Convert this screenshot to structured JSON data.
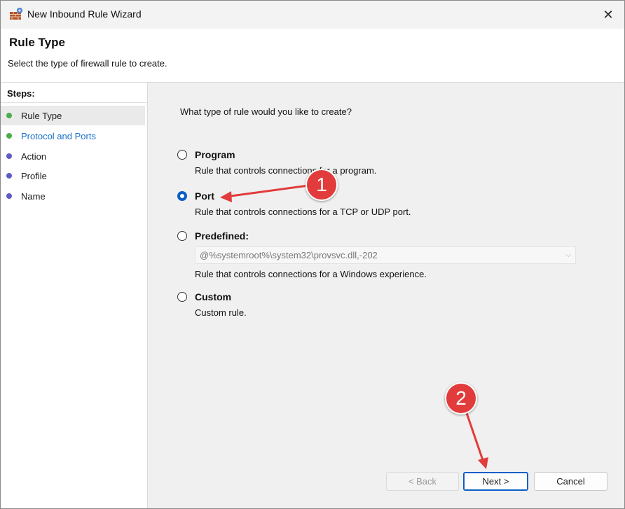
{
  "window": {
    "title": "New Inbound Rule Wizard",
    "close_label": "✕"
  },
  "header": {
    "title": "Rule Type",
    "subtitle": "Select the type of firewall rule to create."
  },
  "steps": {
    "title": "Steps:",
    "items": [
      {
        "label": "Rule Type",
        "dot_color": "#4cae4c"
      },
      {
        "label": "Protocol and Ports",
        "dot_color": "#4cae4c"
      },
      {
        "label": "Action",
        "dot_color": "#5d5bc4"
      },
      {
        "label": "Profile",
        "dot_color": "#5d5bc4"
      },
      {
        "label": "Name",
        "dot_color": "#5d5bc4"
      }
    ]
  },
  "main": {
    "question": "What type of rule would you like to create?",
    "options": [
      {
        "label": "Program",
        "description": "Rule that controls connections for a program.",
        "selected": false
      },
      {
        "label": "Port",
        "description": "Rule that controls connections for a TCP or UDP port.",
        "selected": true
      },
      {
        "label": "Predefined:",
        "description": "Rule that controls connections for a Windows experience.",
        "selected": false
      },
      {
        "label": "Custom",
        "description": "Custom rule.",
        "selected": false
      }
    ],
    "predefined_value": "@%systemroot%\\system32\\provsvc.dll,-202"
  },
  "buttons": {
    "back": "< Back",
    "next": "Next >",
    "cancel": "Cancel"
  },
  "annotations": {
    "badge1": "1",
    "badge2": "2",
    "color": "#e23b3b"
  },
  "colors": {
    "accent": "#0a5ec8",
    "link": "#1a6fc9"
  }
}
